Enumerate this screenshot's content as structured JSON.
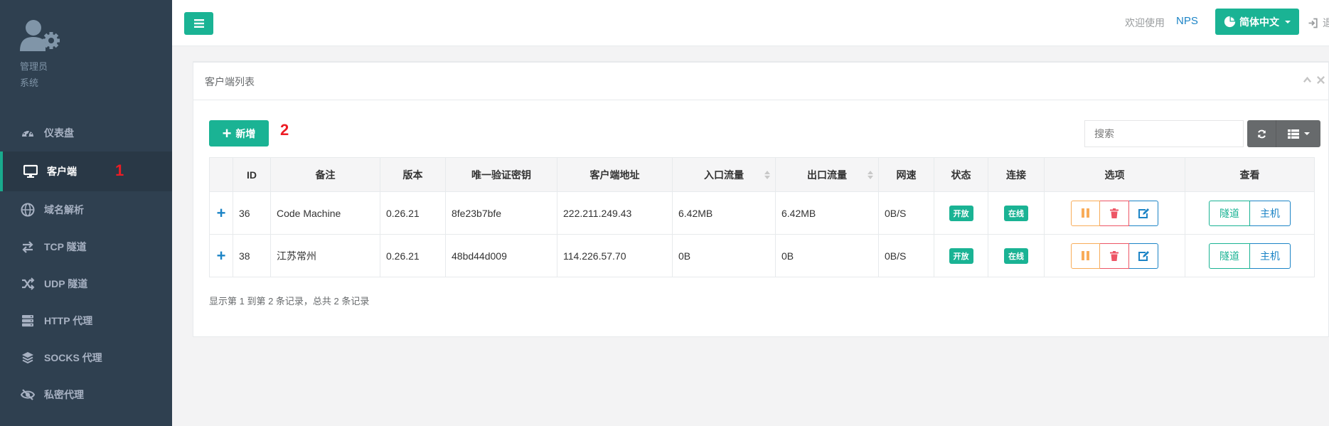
{
  "sidebar": {
    "profile": {
      "role": "管理员",
      "system": "系统"
    },
    "items": [
      {
        "label": "仪表盘",
        "icon": "dashboard-icon",
        "active": false
      },
      {
        "label": "客户端",
        "icon": "desktop-icon",
        "active": true
      },
      {
        "label": "域名解析",
        "icon": "globe-icon",
        "active": false
      },
      {
        "label": "TCP 隧道",
        "icon": "exchange-icon",
        "active": false
      },
      {
        "label": "UDP 隧道",
        "icon": "random-icon",
        "active": false
      },
      {
        "label": "HTTP 代理",
        "icon": "server-icon",
        "active": false
      },
      {
        "label": "SOCKS 代理",
        "icon": "stack-icon",
        "active": false
      },
      {
        "label": "私密代理",
        "icon": "eye-slash-icon",
        "active": false
      }
    ],
    "marker": "1"
  },
  "topbar": {
    "welcome": "欢迎使用",
    "brand": "NPS",
    "language": "简体中文",
    "logout": "退"
  },
  "panel": {
    "title": "客户端列表",
    "add_label": "新增",
    "marker": "2",
    "search_placeholder": "搜索"
  },
  "table": {
    "headers": [
      "ID",
      "备注",
      "版本",
      "唯一验证密钥",
      "客户端地址",
      "入口流量",
      "出口流量",
      "网速",
      "状态",
      "连接",
      "选项",
      "查看"
    ],
    "rows": [
      {
        "id": "36",
        "remark": "Code Machine",
        "version": "0.26.21",
        "vkey": "8fe23b7bfe",
        "addr": "222.211.249.43",
        "inflow": "6.42MB",
        "outflow": "6.42MB",
        "speed": "0B/S",
        "status": "开放",
        "conn": "在线",
        "tunnel": "隧道",
        "host": "主机"
      },
      {
        "id": "38",
        "remark": "江苏常州",
        "version": "0.26.21",
        "vkey": "48bd44d009",
        "addr": "114.226.57.70",
        "inflow": "0B",
        "outflow": "0B",
        "speed": "0B/S",
        "status": "开放",
        "conn": "在线",
        "tunnel": "隧道",
        "host": "主机"
      }
    ],
    "summary": "显示第 1 到第 2 条记录，总共 2 条记录"
  },
  "colors": {
    "sidebar_bg": "#2f4050",
    "accent": "#1ab394",
    "info": "#1c84c6",
    "warning": "#f8ac59",
    "danger": "#ed5565",
    "marker": "#ed1c24"
  }
}
